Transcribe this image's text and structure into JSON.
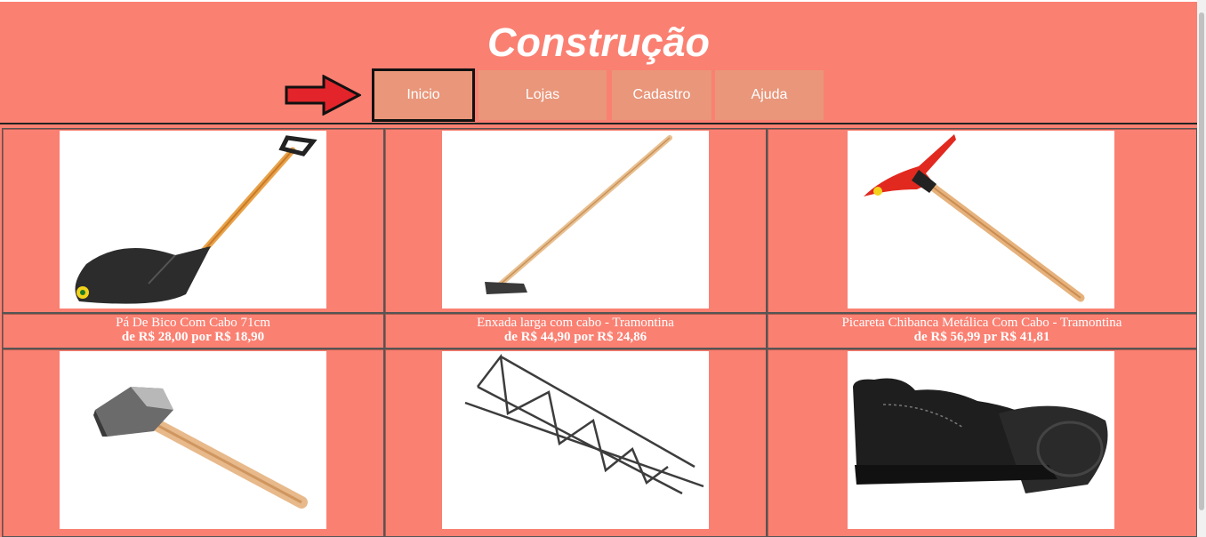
{
  "header": {
    "title": "Construção"
  },
  "nav": {
    "items": [
      {
        "label": "Inicio"
      },
      {
        "label": "Lojas"
      },
      {
        "label": "Cadastro"
      },
      {
        "label": "Ajuda"
      }
    ]
  },
  "products": [
    {
      "name": "Pá De Bico Com Cabo 71cm",
      "price": "de R$ 28,00 por R$ 18,90"
    },
    {
      "name": "Enxada larga com cabo - Tramontina",
      "price": "de R$ 44,90 por R$ 24,86"
    },
    {
      "name": "Picareta Chibanca Metálica Com Cabo - Tramontina",
      "price": "de R$ 56,99 pr R$ 41,81"
    }
  ],
  "images": [
    {
      "icon": "shovel-image"
    },
    {
      "icon": "hoe-image"
    },
    {
      "icon": "pickaxe-image"
    },
    {
      "icon": "sledgehammer-image"
    },
    {
      "icon": "rebar-truss-image"
    },
    {
      "icon": "work-boot-image"
    }
  ],
  "colors": {
    "background": "#fa8072",
    "nav_button": "#e9967a",
    "arrow": "#e3242b"
  }
}
